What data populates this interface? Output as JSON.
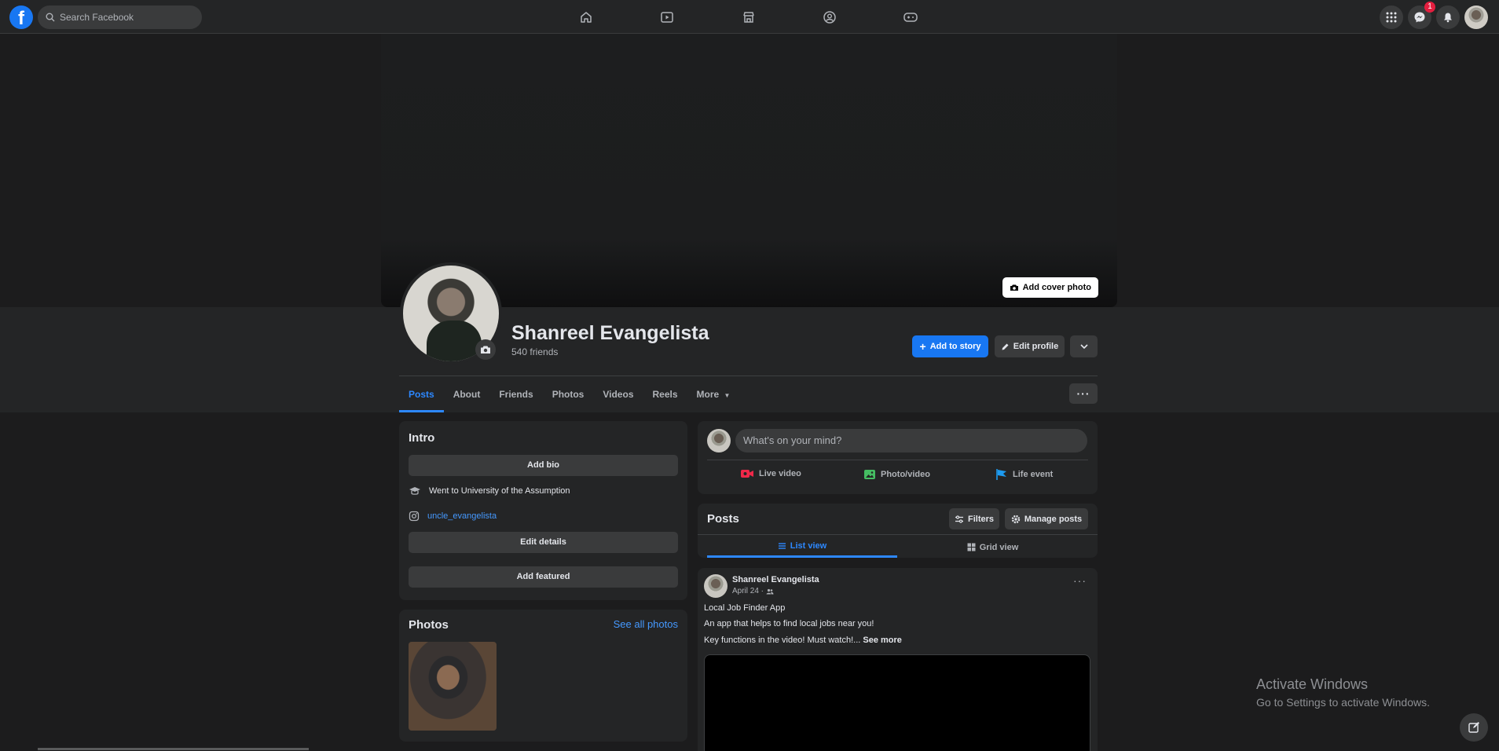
{
  "topbar": {
    "logo": "f",
    "search_placeholder": "Search Facebook",
    "nav_icons": [
      "home-icon",
      "video-icon",
      "marketplace-icon",
      "groups-icon",
      "gaming-icon"
    ],
    "messenger_badge": "1"
  },
  "cover": {
    "add_cover_label": "Add cover photo"
  },
  "profile": {
    "name": "Shanreel Evangelista",
    "friends": "540 friends",
    "add_story_label": "Add to story",
    "edit_profile_label": "Edit profile"
  },
  "tabs": [
    "Posts",
    "About",
    "Friends",
    "Photos",
    "Videos",
    "Reels",
    "More"
  ],
  "intro": {
    "title": "Intro",
    "add_bio": "Add bio",
    "education": "Went to University of the Assumption",
    "instagram": "uncle_evangelista",
    "edit_details": "Edit details",
    "add_featured": "Add featured"
  },
  "photos": {
    "title": "Photos",
    "see_all": "See all photos"
  },
  "composer": {
    "placeholder": "What's on your mind?",
    "live_video": "Live video",
    "photo_video": "Photo/video",
    "life_event": "Life event"
  },
  "posts_header": {
    "title": "Posts",
    "filters": "Filters",
    "manage_posts": "Manage posts",
    "list_view": "List view",
    "grid_view": "Grid view"
  },
  "post": {
    "author": "Shanreel Evangelista",
    "date": "April 24 ·",
    "line1": "Local Job Finder App",
    "line2": "An app that helps to find local jobs near you!",
    "line3": "Key functions in the video! Must watch!...",
    "see_more": "See more"
  },
  "watermark": {
    "title": "Activate Windows",
    "subtitle": "Go to Settings to activate Windows."
  },
  "colors": {
    "accent": "#1877f2",
    "background": "#1c1c1d",
    "card": "#242526"
  }
}
